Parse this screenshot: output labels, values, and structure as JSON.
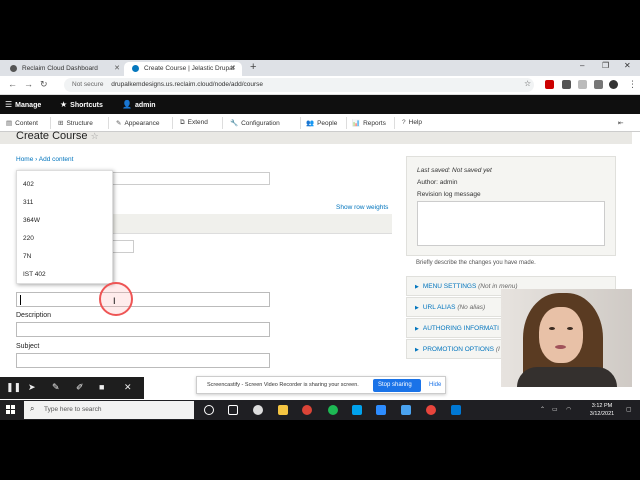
{
  "browser": {
    "tabs": [
      {
        "title": "Reclaim Cloud Dashboard",
        "favicon_color": "#555555"
      },
      {
        "title": "Create Course | Jelastic Drupal",
        "favicon_color": "#0678be"
      }
    ],
    "url_prefix": "Not secure",
    "url": "drupalkemdesigns.us.reclaim.cloud/node/add/course"
  },
  "toolbar": {
    "manage": "Manage",
    "shortcuts": "Shortcuts",
    "user": "admin"
  },
  "tray": {
    "items": [
      "Content",
      "Structure",
      "Appearance",
      "Extend",
      "Configuration",
      "People",
      "Reports",
      "Help"
    ]
  },
  "page": {
    "title": "Create Course",
    "breadcrumb": "Home › Add content",
    "show_row_weights": "Show row weights",
    "dropdown_options": [
      "402",
      "311",
      "364W",
      "220",
      "7N",
      "IST 402"
    ],
    "description_label": "Description",
    "subject_label": "Subject"
  },
  "sidebar": {
    "last_saved": "Last saved: Not saved yet",
    "author": "Author: admin",
    "revision_label": "Revision log message",
    "revision_help": "Briefly describe the changes you have made.",
    "sections": [
      {
        "label": "MENU SETTINGS",
        "sub": "(Not in menu)"
      },
      {
        "label": "URL ALIAS",
        "sub": "(No alias)"
      },
      {
        "label": "AUTHORING INFORMATI",
        "sub": ""
      },
      {
        "label": "PROMOTION OPTIONS",
        "sub": "(I"
      }
    ]
  },
  "screencastify": {
    "share_text": "Screencastify - Screen Video Recorder is sharing your screen.",
    "stop": "Stop sharing",
    "hide": "Hide"
  },
  "taskbar": {
    "search_placeholder": "Type here to search",
    "time": "3:12 PM",
    "date": "3/12/2021"
  }
}
